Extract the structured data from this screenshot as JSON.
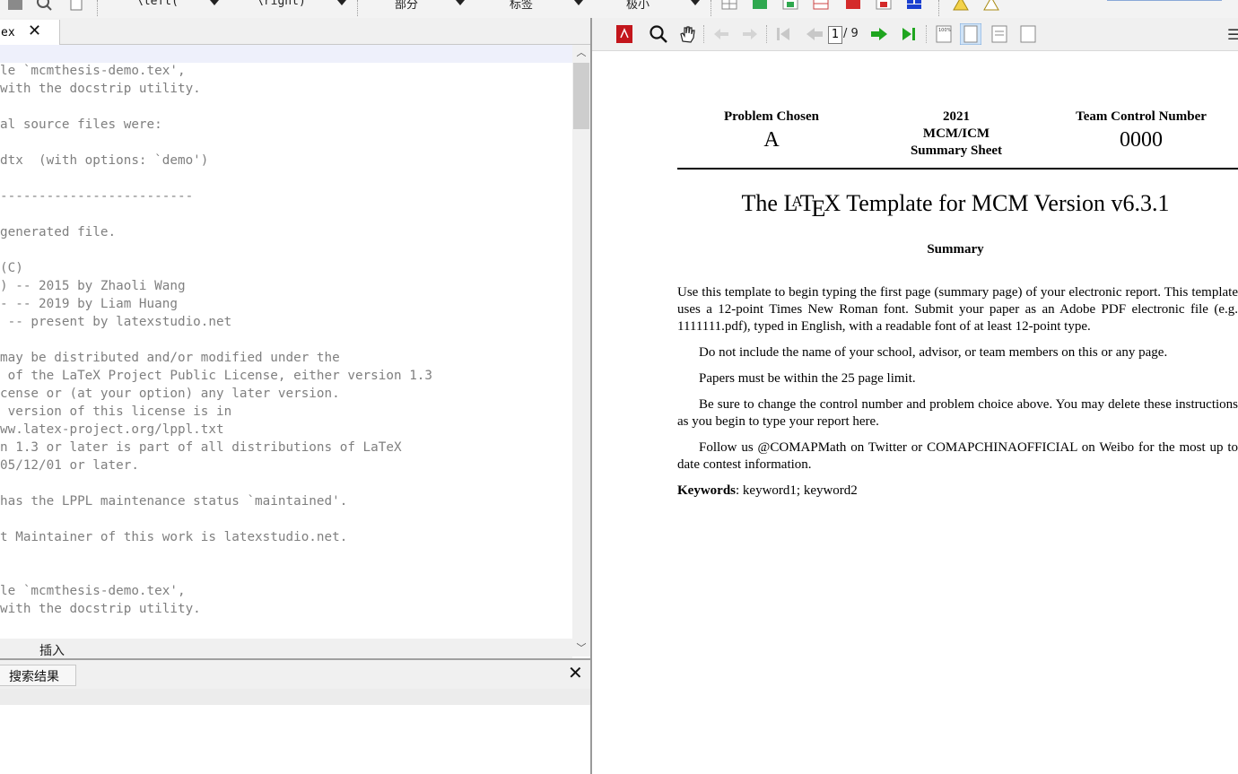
{
  "toolbar": {
    "combo_left": "\\left(",
    "combo_right": "\\right)",
    "combo_part": "部分",
    "combo_label": "标签",
    "combo_size": "极小"
  },
  "editor": {
    "tab_label": "ex",
    "lines": [
      "le `mcmthesis-demo.tex',",
      "with the docstrip utility.",
      "",
      "al source files were:",
      "",
      "dtx  (with options: `demo')",
      "",
      "-------------------------",
      "",
      "generated file.",
      "",
      "(C)",
      ") -- 2015 by Zhaoli Wang",
      "- -- 2019 by Liam Huang",
      " -- present by latexstudio.net",
      "",
      "may be distributed and/or modified under the",
      " of the LaTeX Project Public License, either version 1.3",
      "cense or (at your option) any later version.",
      " version of this license is in",
      "ww.latex-project.org/lppl.txt",
      "n 1.3 or later is part of all distributions of LaTeX",
      "05/12/01 or later.",
      "",
      "has the LPPL maintenance status `maintained'.",
      "",
      "t Maintainer of this work is latexstudio.net.",
      "",
      "",
      "le `mcmthesis-demo.tex',",
      "with the docstrip utility."
    ],
    "status_mode": "插入",
    "search_tab": "搜索结果"
  },
  "viewer": {
    "page_current": "1",
    "page_total": "/ 9",
    "header": {
      "problem_label": "Problem Chosen",
      "problem_value": "A",
      "year": "2021",
      "contest": "MCM/ICM",
      "sheet": "Summary Sheet",
      "team_label": "Team Control Number",
      "team_value": "0000"
    },
    "title_pre": "The L",
    "title_a": "A",
    "title_t": "T",
    "title_e": "E",
    "title_x": "X",
    "title_post": " Template for MCM Version v6.3.1",
    "summary_heading": "Summary",
    "paragraphs": [
      "Use this template to begin typing the first page (summary page) of your electronic report. This template uses a 12-point Times New Roman font. Submit your paper as an Adobe PDF electronic file (e.g. 1111111.pdf), typed in English, with a readable font of at least 12-point type.",
      "Do not include the name of your school, advisor, or team members on this or any page.",
      "Papers must be within the 25 page limit.",
      "Be sure to change the control number and problem choice above. You may delete these instructions as you begin to type your report here.",
      "Follow us @COMAPMath on Twitter or COMAPCHINAOFFICIAL on Weibo for the most up to date contest information."
    ],
    "keywords_label": "Keywords",
    "keywords_value": ": keyword1; keyword2"
  }
}
